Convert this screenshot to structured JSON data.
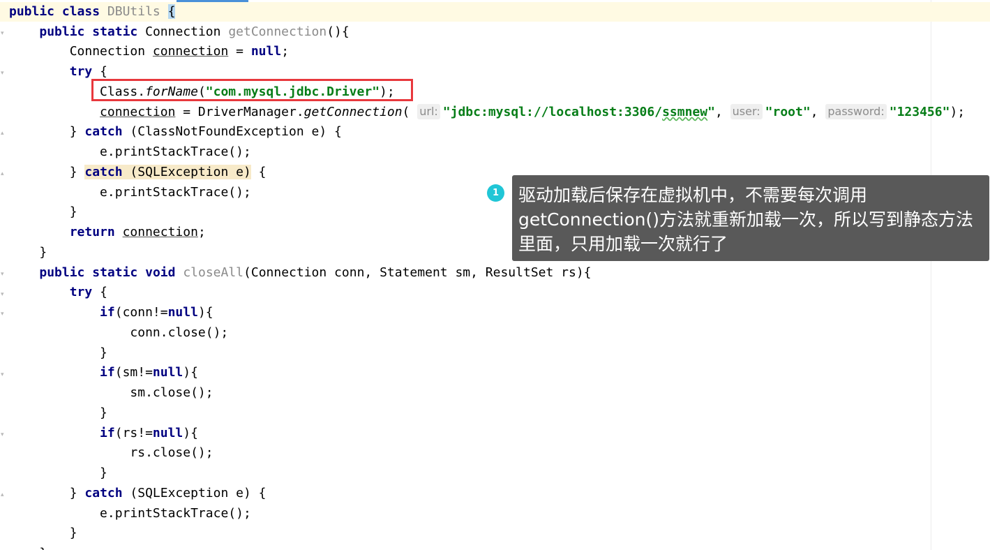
{
  "code": {
    "line_class": [
      "public",
      "class",
      "DBUtils",
      "{"
    ],
    "getconn_sig": [
      "public",
      "static",
      "Connection",
      "getConnection",
      "(){"
    ],
    "conn_decl": [
      "Connection",
      "connection",
      "=",
      "null",
      ";"
    ],
    "try": [
      "try",
      "{"
    ],
    "forname": [
      "Class.",
      "forName",
      "(",
      "\"com.mysql.jdbc.Driver\"",
      ");"
    ],
    "getconn_call": {
      "target": "connection",
      "eq": " = DriverManager.",
      "method": "getConnection",
      "open": "(",
      "hint_url": "url:",
      "url_a": "\"jdbc:mysql://localhost:3306/",
      "url_b": "ssmnew",
      "url_c": "\"",
      "comma1": ",",
      "hint_user": "user:",
      "user": "\"root\"",
      "comma2": ",",
      "hint_password": "password:",
      "password": "\"123456\"",
      "close": ");"
    },
    "catch1": [
      "} ",
      "catch",
      " (ClassNotFoundException e) {"
    ],
    "print1": "e.printStackTrace();",
    "catch2": [
      "} ",
      "catch",
      " (SQLException e)",
      " {"
    ],
    "print2": "e.printStackTrace();",
    "brace_close": "}",
    "return": [
      "return",
      "connection",
      ";"
    ],
    "method_end": "}",
    "closeall_sig": [
      "public",
      "static",
      "void",
      "closeAll",
      "(Connection conn, Statement sm, ResultSet rs){"
    ],
    "try2": [
      "try",
      "{"
    ],
    "if_conn": [
      "if",
      "(conn!=",
      "null",
      "){"
    ],
    "conn_close": "conn.close();",
    "brace_a": "}",
    "if_sm": [
      "if",
      "(sm!=",
      "null",
      "){"
    ],
    "sm_close": "sm.close();",
    "brace_b": "}",
    "if_rs": [
      "if",
      "(rs!=",
      "null",
      "){"
    ],
    "rs_close": "rs.close();",
    "brace_c": "}",
    "catch3": [
      "} ",
      "catch",
      " (SQLException e) {"
    ],
    "print3": "e.printStackTrace();",
    "brace_d": "}",
    "partial_last": "}"
  },
  "annotation": {
    "badge": "1",
    "text": "驱动加载后保存在虚拟机中，不需要每次调用getConnection()方法就重新加载一次，所以写到静态方法里面，只用加载一次就行了"
  },
  "colors": {
    "keyword": "#000080",
    "string": "#067d17",
    "highlight_box": "#e8383d",
    "tooltip_bg": "#595959",
    "badge": "#20c6d6"
  }
}
